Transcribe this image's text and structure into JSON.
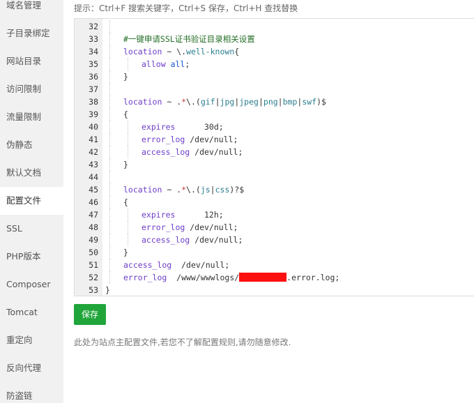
{
  "sidebar": {
    "items": [
      {
        "label": "域名管理",
        "active": false
      },
      {
        "label": "子目录绑定",
        "active": false
      },
      {
        "label": "网站目录",
        "active": false
      },
      {
        "label": "访问限制",
        "active": false
      },
      {
        "label": "流量限制",
        "active": false
      },
      {
        "label": "伪静态",
        "active": false
      },
      {
        "label": "默认文档",
        "active": false
      },
      {
        "label": "配置文件",
        "active": true
      },
      {
        "label": "SSL",
        "active": false
      },
      {
        "label": "PHP版本",
        "active": false
      },
      {
        "label": "Composer",
        "active": false
      },
      {
        "label": "Tomcat",
        "active": false
      },
      {
        "label": "重定向",
        "active": false
      },
      {
        "label": "反向代理",
        "active": false
      },
      {
        "label": "防盗链",
        "active": false
      }
    ]
  },
  "hint": "提示：Ctrl+F 搜索关键字，Ctrl+S 保存，Ctrl+H 查找替换",
  "editor": {
    "lines": [
      {
        "num": "32",
        "indent": 1,
        "tokens": []
      },
      {
        "num": "33",
        "indent": 1,
        "tokens": [
          {
            "t": "#一键申请SSL证书验证目录相关设置",
            "c": "comment"
          }
        ]
      },
      {
        "num": "34",
        "indent": 1,
        "tokens": [
          {
            "t": "location",
            "c": "kw"
          },
          {
            "t": " ~ \\.",
            "c": ""
          },
          {
            "t": "well-known",
            "c": "str"
          },
          {
            "t": "{",
            "c": ""
          }
        ]
      },
      {
        "num": "35",
        "indent": 2,
        "tokens": [
          {
            "t": "allow",
            "c": "kw"
          },
          {
            "t": " ",
            "c": ""
          },
          {
            "t": "all",
            "c": "val"
          },
          {
            "t": ";",
            "c": ""
          }
        ]
      },
      {
        "num": "36",
        "indent": 1,
        "tokens": [
          {
            "t": "}",
            "c": ""
          }
        ]
      },
      {
        "num": "37",
        "indent": 1,
        "tokens": []
      },
      {
        "num": "38",
        "indent": 1,
        "tokens": [
          {
            "t": "location",
            "c": "kw"
          },
          {
            "t": " ~ .",
            "c": ""
          },
          {
            "t": "*",
            "c": "red"
          },
          {
            "t": "\\.(",
            "c": ""
          },
          {
            "t": "gif",
            "c": "str"
          },
          {
            "t": "|",
            "c": ""
          },
          {
            "t": "jpg",
            "c": "str"
          },
          {
            "t": "|",
            "c": ""
          },
          {
            "t": "jpeg",
            "c": "str"
          },
          {
            "t": "|",
            "c": ""
          },
          {
            "t": "png",
            "c": "str"
          },
          {
            "t": "|",
            "c": ""
          },
          {
            "t": "bmp",
            "c": "str"
          },
          {
            "t": "|",
            "c": ""
          },
          {
            "t": "swf",
            "c": "str"
          },
          {
            "t": ")$",
            "c": ""
          }
        ]
      },
      {
        "num": "39",
        "indent": 1,
        "tokens": [
          {
            "t": "{",
            "c": ""
          }
        ]
      },
      {
        "num": "40",
        "indent": 2,
        "tokens": [
          {
            "t": "expires",
            "c": "kw"
          },
          {
            "t": "      30d;",
            "c": ""
          }
        ]
      },
      {
        "num": "41",
        "indent": 2,
        "tokens": [
          {
            "t": "error_log",
            "c": "kw"
          },
          {
            "t": " /dev/null;",
            "c": ""
          }
        ]
      },
      {
        "num": "42",
        "indent": 2,
        "tokens": [
          {
            "t": "access_log",
            "c": "kw"
          },
          {
            "t": " /dev/null;",
            "c": ""
          }
        ]
      },
      {
        "num": "43",
        "indent": 1,
        "tokens": [
          {
            "t": "}",
            "c": ""
          }
        ]
      },
      {
        "num": "44",
        "indent": 1,
        "tokens": []
      },
      {
        "num": "45",
        "indent": 1,
        "tokens": [
          {
            "t": "location",
            "c": "kw"
          },
          {
            "t": " ~ .",
            "c": ""
          },
          {
            "t": "*",
            "c": "red"
          },
          {
            "t": "\\.(",
            "c": ""
          },
          {
            "t": "js",
            "c": "str"
          },
          {
            "t": "|",
            "c": ""
          },
          {
            "t": "css",
            "c": "str"
          },
          {
            "t": ")?$",
            "c": ""
          }
        ]
      },
      {
        "num": "46",
        "indent": 1,
        "tokens": [
          {
            "t": "{",
            "c": ""
          }
        ]
      },
      {
        "num": "47",
        "indent": 2,
        "tokens": [
          {
            "t": "expires",
            "c": "kw"
          },
          {
            "t": "      12h;",
            "c": ""
          }
        ]
      },
      {
        "num": "48",
        "indent": 2,
        "tokens": [
          {
            "t": "error_log",
            "c": "kw"
          },
          {
            "t": " /dev/null;",
            "c": ""
          }
        ]
      },
      {
        "num": "49",
        "indent": 2,
        "tokens": [
          {
            "t": "access_log",
            "c": "kw"
          },
          {
            "t": " /dev/null;",
            "c": ""
          }
        ]
      },
      {
        "num": "50",
        "indent": 1,
        "tokens": [
          {
            "t": "}",
            "c": ""
          }
        ]
      },
      {
        "num": "51",
        "indent": 1,
        "tokens": [
          {
            "t": "access_log",
            "c": "kw"
          },
          {
            "t": "  /dev/null;",
            "c": ""
          }
        ]
      },
      {
        "num": "52",
        "indent": 1,
        "tokens": [
          {
            "t": "error_log",
            "c": "kw"
          },
          {
            "t": "  /www/wwwlogs/",
            "c": ""
          },
          {
            "t": "",
            "c": "redact"
          },
          {
            "t": ".error.log;",
            "c": ""
          }
        ]
      },
      {
        "num": "53",
        "indent": 0,
        "tokens": [
          {
            "t": "}",
            "c": ""
          }
        ]
      }
    ]
  },
  "save_label": "保存",
  "note": "此处为站点主配置文件,若您不了解配置规则,请勿随意修改.",
  "colors": {
    "accent": "#20a53a",
    "sidebar_bg": "#f1f1f1",
    "comment": "#236e25",
    "keyword": "#6d3dc7",
    "redaction": "#ff1010"
  }
}
